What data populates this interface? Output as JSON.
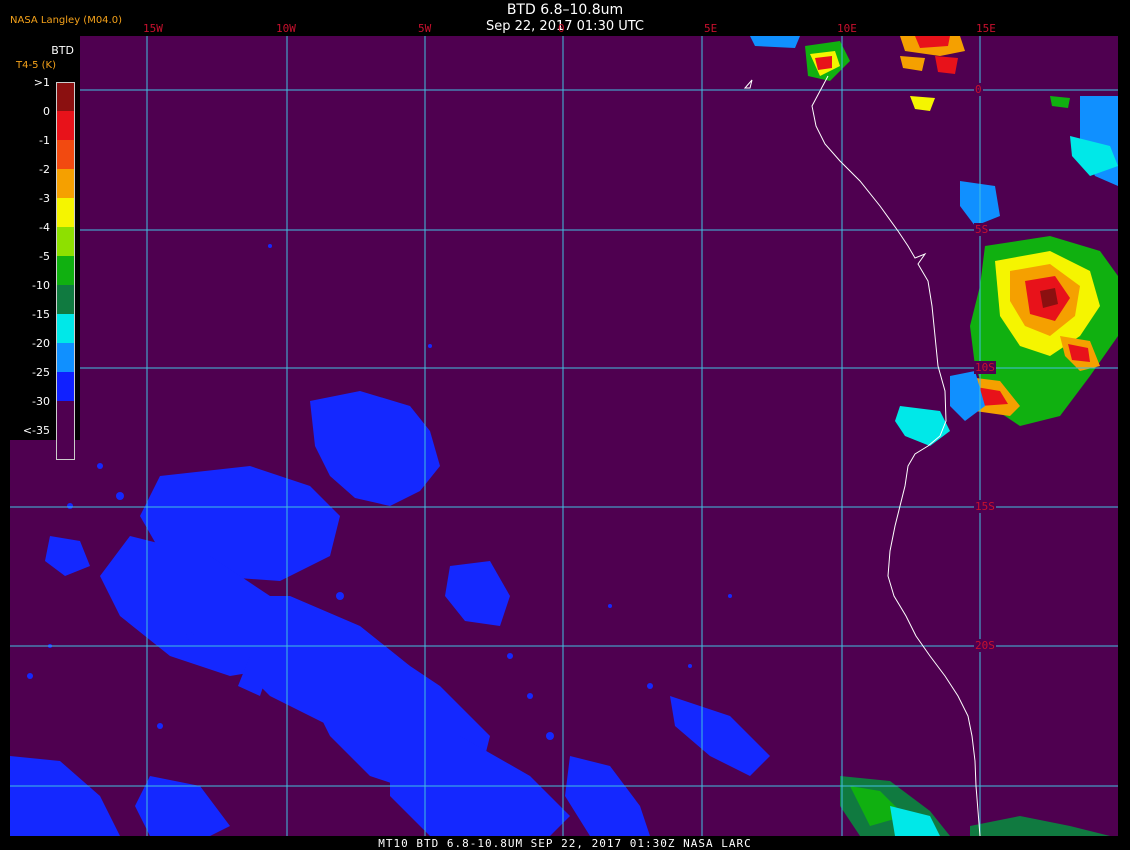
{
  "header": {
    "title": "BTD 6.8–10.8um",
    "timestamp": "Sep 22, 2017 01:30 UTC",
    "organization": "NASA Langley (M04.0)"
  },
  "footer": {
    "caption": "MT10  BTD 6.8-10.8UM   SEP 22, 2017 01:30Z   NASA LARC"
  },
  "longitude_labels": [
    "15W",
    "10W",
    "5W",
    "0",
    "5E",
    "10E",
    "15E"
  ],
  "latitude_labels": [
    "0",
    "5S",
    "10S",
    "15S",
    "20S"
  ],
  "legend": {
    "title": "BTD",
    "subtitle": "T4-5 (K)",
    "items": [
      {
        "label": ">1",
        "color": "#8b1010"
      },
      {
        "label": "0",
        "color": "#e8121a"
      },
      {
        "label": "-1",
        "color": "#f24a10"
      },
      {
        "label": "-2",
        "color": "#f5a000"
      },
      {
        "label": "-3",
        "color": "#f5f500"
      },
      {
        "label": "-4",
        "color": "#8ee000"
      },
      {
        "label": "-5",
        "color": "#10b010"
      },
      {
        "label": "-10",
        "color": "#107a40"
      },
      {
        "label": "-15",
        "color": "#00e8e8"
      },
      {
        "label": "-20",
        "color": "#1090ff"
      },
      {
        "label": "-25",
        "color": "#1020ff"
      },
      {
        "label": "-30",
        "color": "#4f0050"
      },
      {
        "label": "<-35",
        "color": "#4f0050"
      }
    ]
  },
  "colors": {
    "background": "#4f0050",
    "grid": "#40c0e0",
    "coastline": "#ffffff",
    "label": "#c8102e"
  }
}
